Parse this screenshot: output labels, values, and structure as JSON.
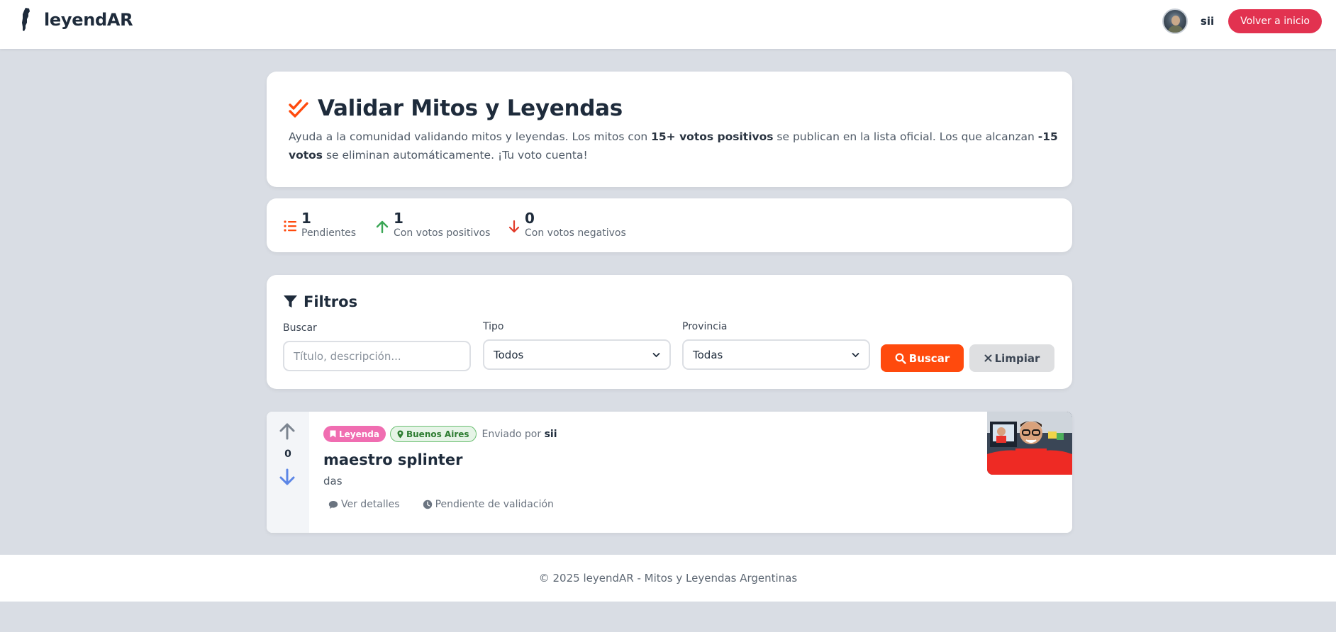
{
  "navbar": {
    "brand": "leyendAR",
    "username": "sii",
    "home_button": "Volver a inicio"
  },
  "hero": {
    "title": "Validar Mitos y Leyendas",
    "desc_part1": "Ayuda a la comunidad validando mitos y leyendas. Los mitos con ",
    "desc_bold1": "15+ votos positivos",
    "desc_part2": " se publican en la lista oficial. Los que alcanzan ",
    "desc_bold2": "-15 votos",
    "desc_part3": " se eliminan automáticamente. ¡Tu voto cuenta!"
  },
  "stats": [
    {
      "value": "1",
      "label": "Pendientes",
      "icon": "list-icon",
      "color": "#ff4a0d"
    },
    {
      "value": "1",
      "label": "Con votos positivos",
      "icon": "arrow-up-icon",
      "color": "#3aa655"
    },
    {
      "value": "0",
      "label": "Con votos negativos",
      "icon": "arrow-down-icon",
      "color": "#e23b2a"
    }
  ],
  "filters": {
    "title": "Filtros",
    "search_label": "Buscar",
    "search_placeholder": "Título, descripción...",
    "type_label": "Tipo",
    "type_value": "Todos",
    "province_label": "Provincia",
    "province_value": "Todas",
    "search_button": "Buscar",
    "clear_button": "Limpiar"
  },
  "items": [
    {
      "votes": "0",
      "type": "Leyenda",
      "province": "Buenos Aires",
      "sent_by_label": "Enviado por",
      "author": "sii",
      "title": "maestro splinter",
      "description": "das",
      "details_link": "Ver detalles",
      "status": "Pendiente de validación"
    }
  ],
  "footer": {
    "text": "© 2025 leyendAR - Mitos y Leyendas Argentinas"
  },
  "colors": {
    "accent": "#ff4a0d",
    "home_button": "#e23250",
    "badge_type": "#f06db1",
    "badge_province": "#2e7d32",
    "background": "#d9dde4"
  }
}
